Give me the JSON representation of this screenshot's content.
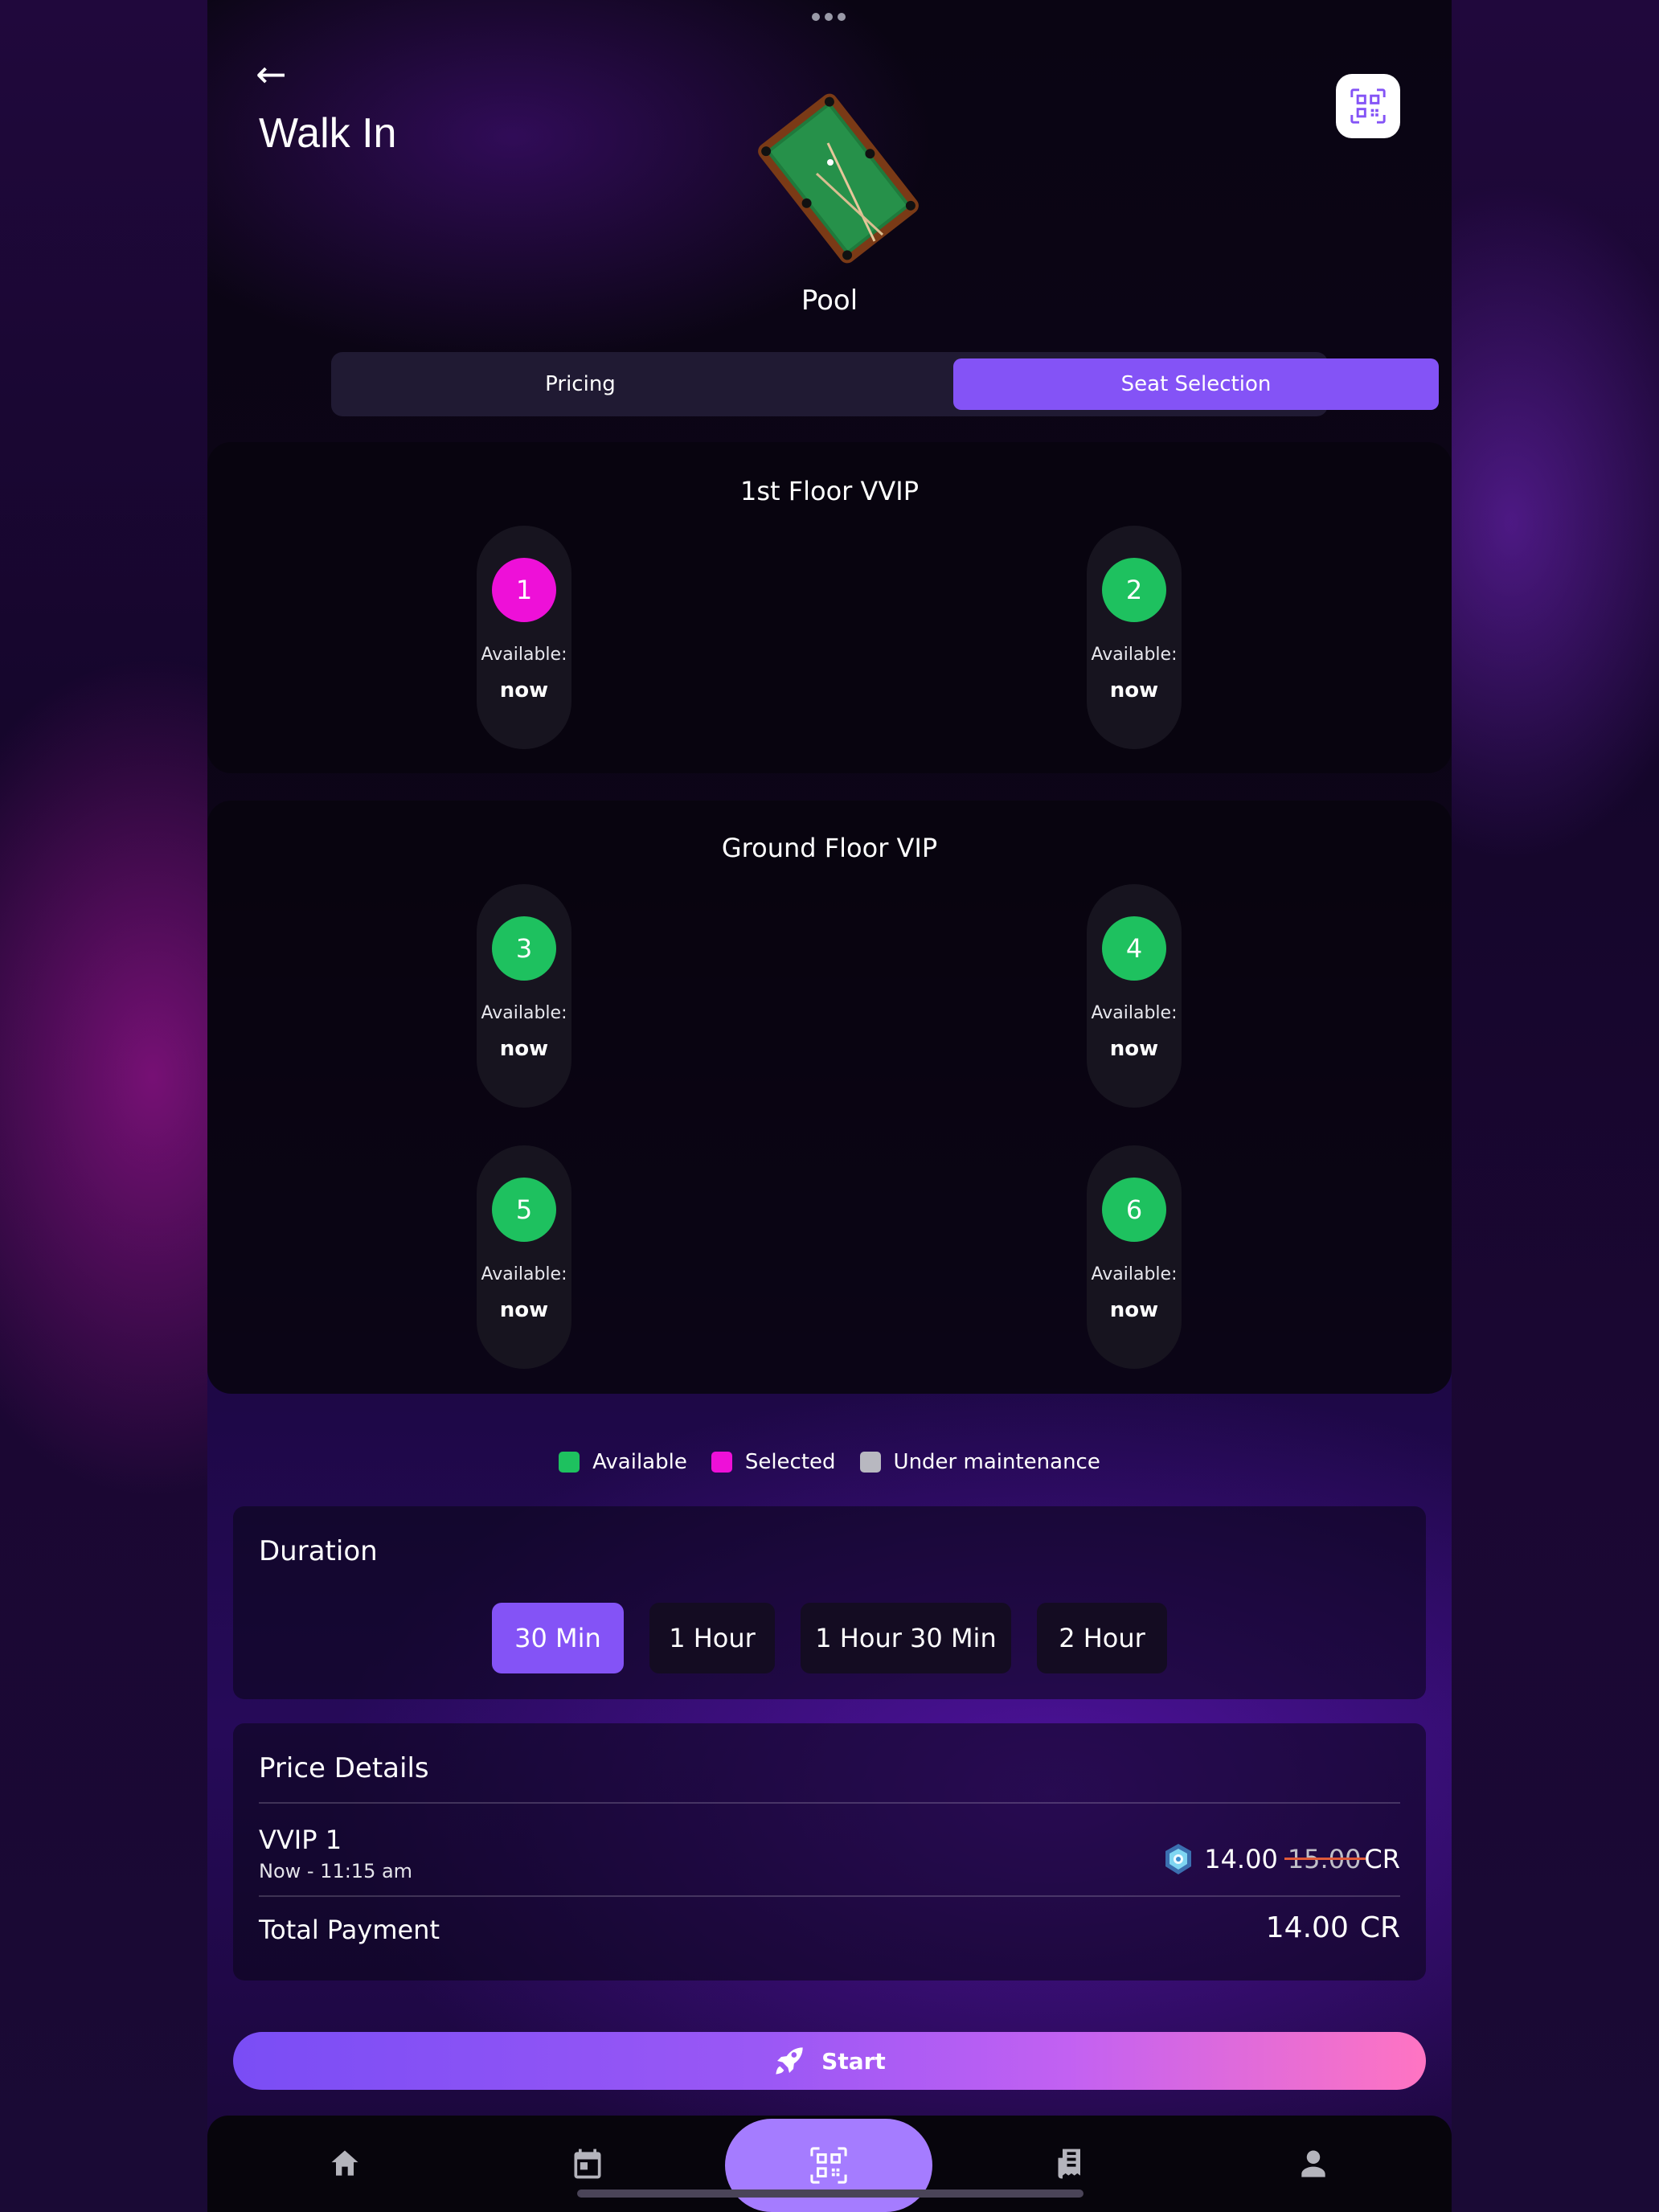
{
  "header": {
    "title": "Walk In",
    "back_icon": "←",
    "game_name": "Pool",
    "qr_icon": "qr-scan-icon"
  },
  "tabs": [
    {
      "label": "Pricing",
      "active": false
    },
    {
      "label": "Seat Selection",
      "active": true
    }
  ],
  "sections": [
    {
      "title": "1st Floor VVIP",
      "seats": [
        {
          "number": "1",
          "status": "selected",
          "avail_label": "Available:",
          "avail_value": "now"
        },
        {
          "number": "2",
          "status": "available",
          "avail_label": "Available:",
          "avail_value": "now"
        }
      ]
    },
    {
      "title": "Ground Floor VIP",
      "seats": [
        {
          "number": "3",
          "status": "available",
          "avail_label": "Available:",
          "avail_value": "now"
        },
        {
          "number": "4",
          "status": "available",
          "avail_label": "Available:",
          "avail_value": "now"
        },
        {
          "number": "5",
          "status": "available",
          "avail_label": "Available:",
          "avail_value": "now"
        },
        {
          "number": "6",
          "status": "available",
          "avail_label": "Available:",
          "avail_value": "now"
        }
      ]
    }
  ],
  "legend": [
    {
      "label": "Available",
      "color": "#1ec15f"
    },
    {
      "label": "Selected",
      "color": "#ee10d8"
    },
    {
      "label": "Under maintenance",
      "color": "#b8b8c0"
    }
  ],
  "duration": {
    "title": "Duration",
    "options": [
      {
        "label": "30 Min",
        "selected": true
      },
      {
        "label": "1 Hour",
        "selected": false
      },
      {
        "label": "1 Hour 30 Min",
        "selected": false
      },
      {
        "label": "2 Hour",
        "selected": false
      }
    ]
  },
  "price_details": {
    "title": "Price Details",
    "item_name": "VVIP 1",
    "item_time": "Now - 11:15 am",
    "price": "14.00",
    "original_price": "15.00",
    "currency": "CR",
    "total_label": "Total Payment",
    "total_value": "14.00",
    "total_currency": "CR"
  },
  "start_button": {
    "label": "Start",
    "icon": "rocket-icon"
  },
  "nav": [
    {
      "name": "home-icon"
    },
    {
      "name": "calendar-icon"
    },
    {
      "name": "qr-scan-icon"
    },
    {
      "name": "receipt-icon"
    },
    {
      "name": "profile-icon"
    }
  ],
  "colors": {
    "accent": "#8453f6",
    "available": "#1ec15f",
    "selected": "#ee10d8",
    "maintenance": "#b8b8c0"
  }
}
